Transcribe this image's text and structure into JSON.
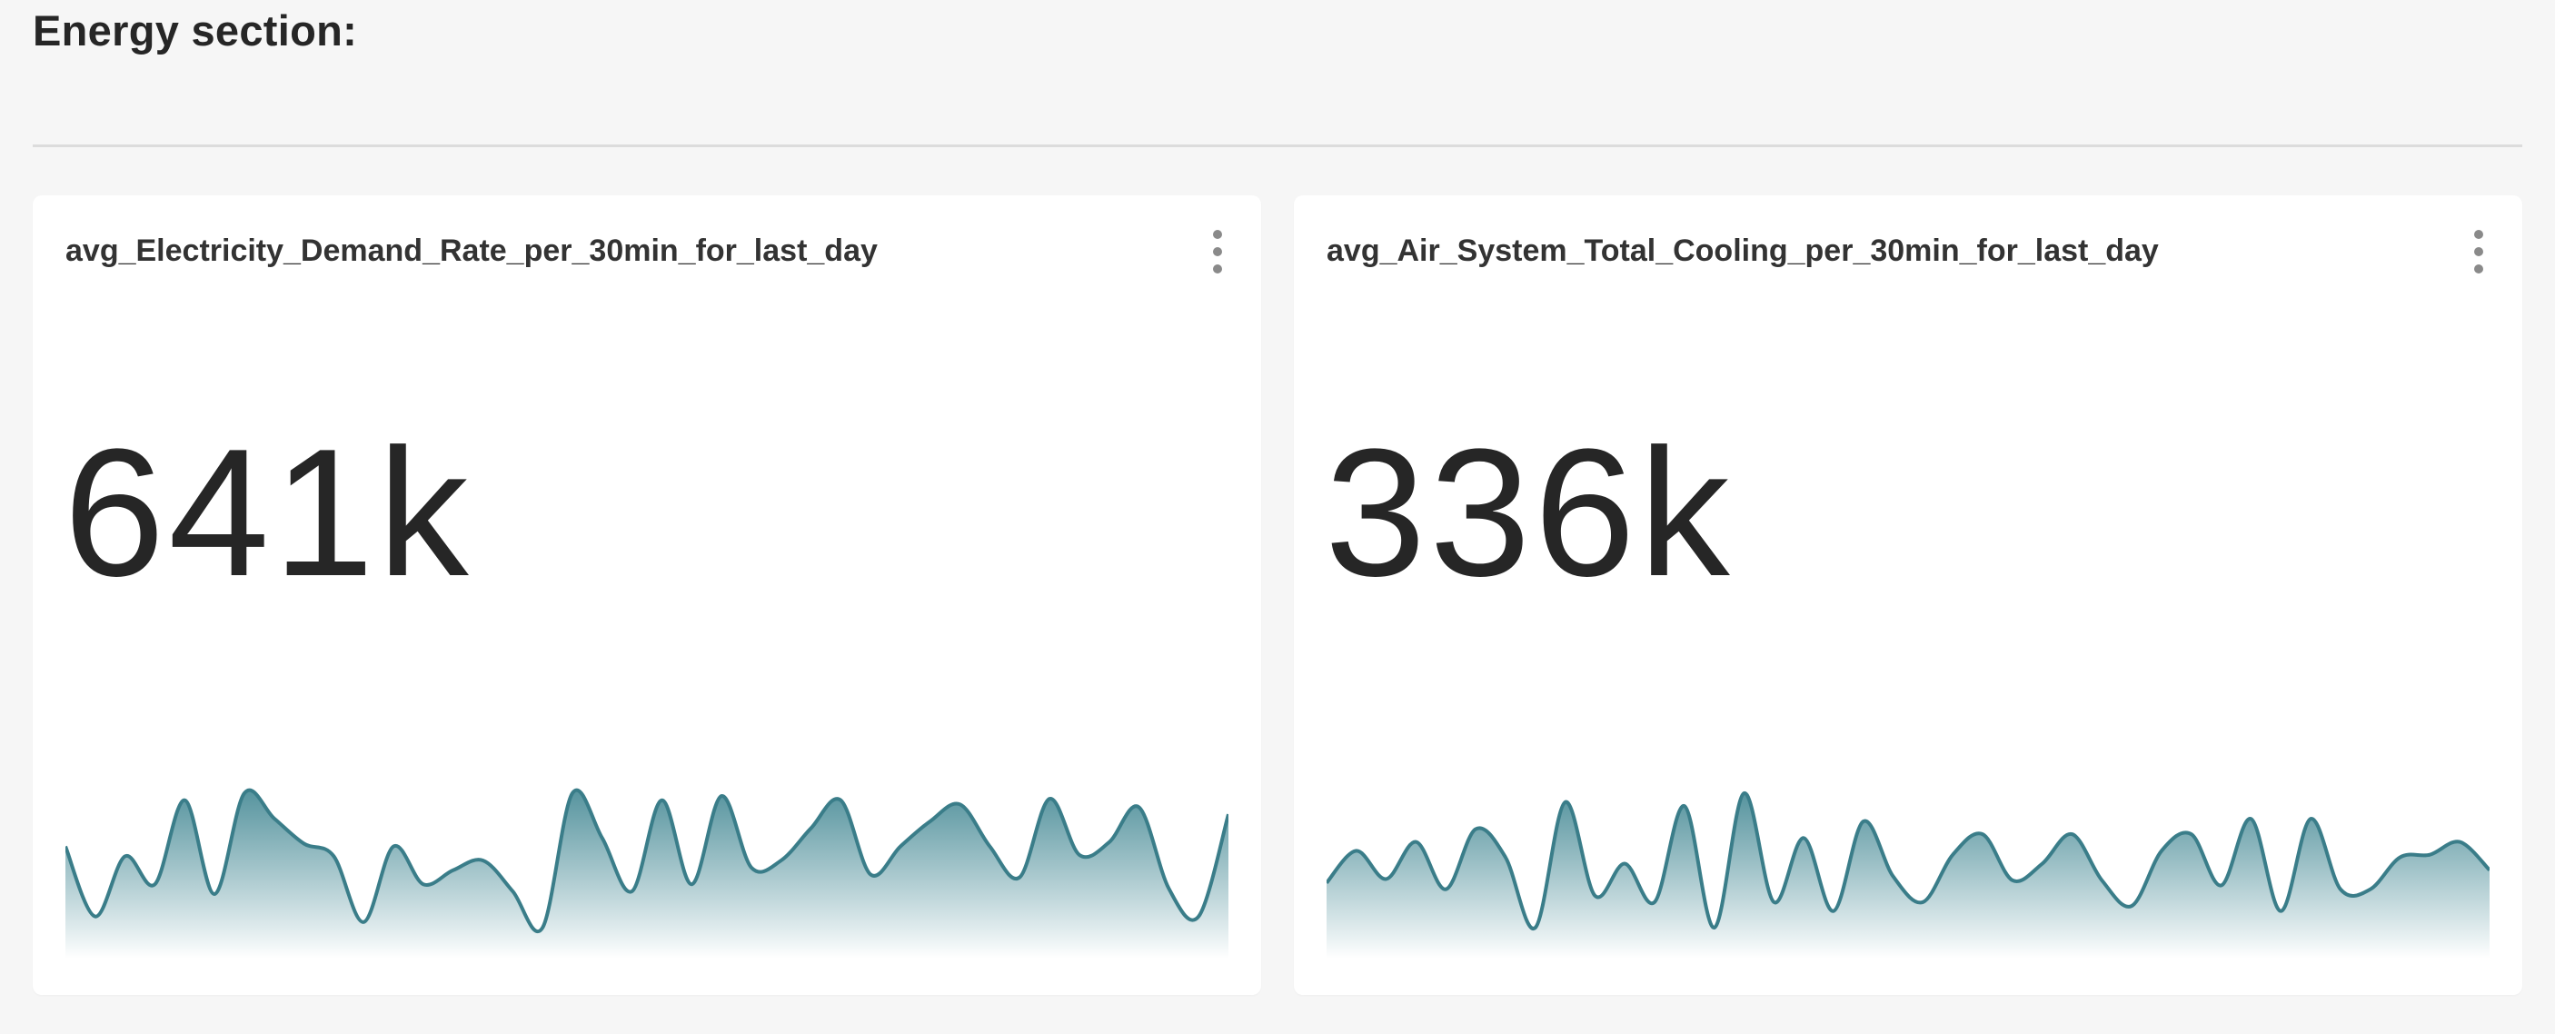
{
  "section": {
    "title": "Energy section:"
  },
  "colors": {
    "line": "#3a7d89",
    "fill_top": "#4d8e99",
    "fill_bottom": "#ffffff"
  },
  "cards": [
    {
      "title": "avg_Electricity_Demand_Rate_per_30min_for_last_day",
      "value": "641k",
      "menu_icon": "more-vertical-icon",
      "series": [
        62,
        12,
        55,
        35,
        95,
        28,
        100,
        82,
        64,
        55,
        8,
        62,
        35,
        45,
        52,
        30,
        4,
        100,
        68,
        30,
        95,
        35,
        98,
        47,
        52,
        75,
        95,
        42,
        62,
        80,
        92,
        62,
        40,
        96,
        56,
        65,
        90,
        32,
        12,
        85
      ]
    },
    {
      "title": "avg_Air_System_Total_Cooling_per_30min_for_last_day",
      "value": "336k",
      "menu_icon": "more-vertical-icon",
      "series": [
        40,
        65,
        43,
        72,
        35,
        82,
        60,
        5,
        103,
        30,
        55,
        25,
        100,
        5,
        110,
        25,
        75,
        18,
        88,
        45,
        25,
        62,
        78,
        42,
        55,
        78,
        42,
        22,
        65,
        78,
        38,
        90,
        18,
        90,
        35,
        35,
        60,
        62,
        72,
        50
      ]
    }
  ]
}
